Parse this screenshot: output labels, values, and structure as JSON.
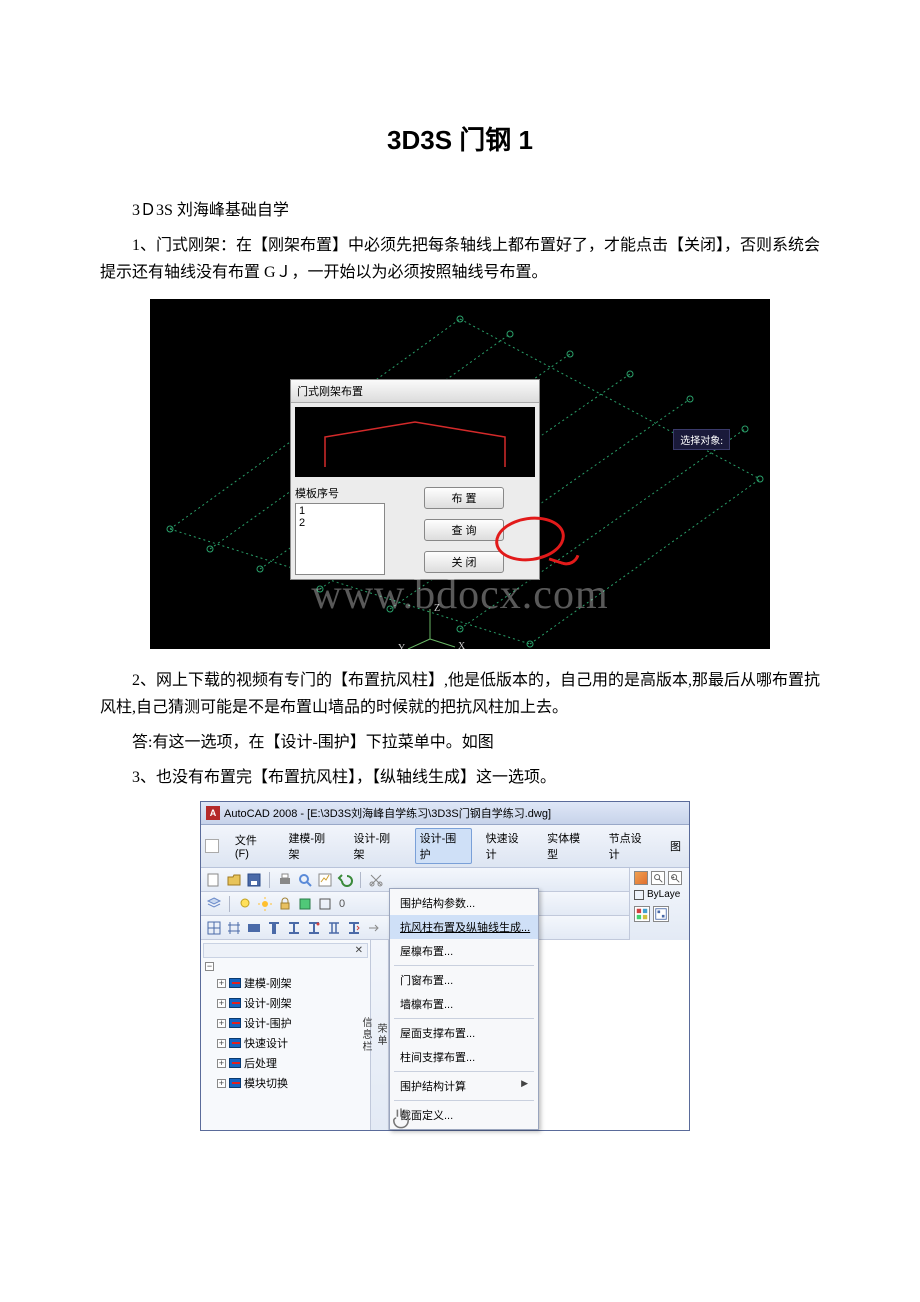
{
  "title": "3D3S 门钢 1",
  "p_intro": "3Ｄ3S 刘海峰基础自学",
  "p1": "1、门式刚架：在【刚架布置】中必须先把每条轴线上都布置好了，才能点击【关闭】，否则系统会提示还有轴线没有布置 GＪ，一开始以为必须按照轴线号布置。",
  "shot1": {
    "watermark": "www.bdocx.com",
    "tooltip": "选择对象:",
    "dialog": {
      "title": "门式刚架布置",
      "list_label": "模板序号",
      "list_items": [
        "1",
        "2"
      ],
      "btn_place": "布  置",
      "btn_query": "查  询",
      "btn_close": "关  闭"
    },
    "axis_z": "Z",
    "axis_x": "X",
    "axis_y": "Y"
  },
  "p2": "2、网上下载的视频有专门的【布置抗风柱】,他是低版本的，自己用的是高版本,那最后从哪布置抗风柱,自己猜测可能是不是布置山墙品的时候就的把抗风柱加上去。",
  "p_answer": "答:有这一选项，在【设计-围护】下拉菜单中。如图",
  "p3": "3、也没有布置完【布置抗风柱】，【纵轴线生成】这一选项。",
  "shot2": {
    "window_title": "AutoCAD 2008 - [E:\\3D3S刘海峰自学练习\\3D3S门钢自学练习.dwg]",
    "menus": {
      "file": "文件(F)",
      "m1": "建模-刚架",
      "m2": "设计-刚架",
      "m3": "设计-围护",
      "m4": "快速设计",
      "m5": "实体模型",
      "m6": "节点设计",
      "m7": "图"
    },
    "tree": {
      "n1": "建模-刚架",
      "n2": "设计-刚架",
      "n3": "设计-围护",
      "n4": "快速设计",
      "n5": "后处理",
      "n6": "模块切换"
    },
    "vstrip_top": "荣单",
    "vstrip_bottom": "信息栏",
    "dropdown": {
      "i1": "围护结构参数...",
      "i2": "抗风柱布置及纵轴线生成...",
      "i3": "屋檩布置...",
      "i4": "门窗布置...",
      "i5": "墙檩布置...",
      "i6": "屋面支撑布置...",
      "i7": "柱间支撑布置...",
      "i8": "围护结构计算",
      "i9": "截面定义..."
    },
    "bylayer": "ByLaye"
  }
}
